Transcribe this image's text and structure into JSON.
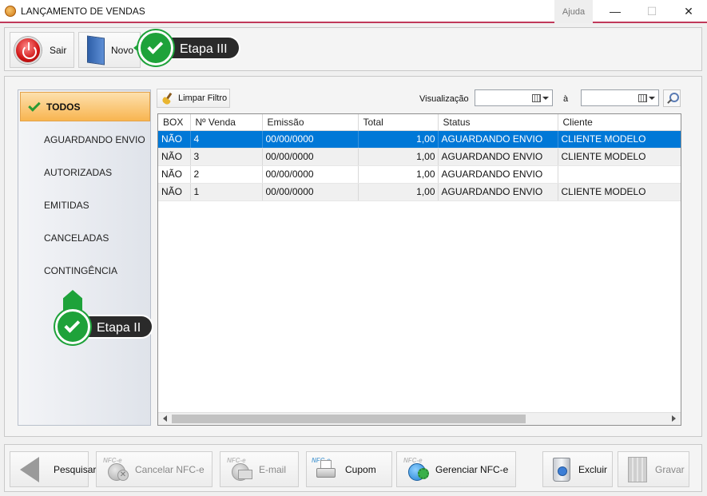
{
  "window": {
    "title": "LANÇAMENTO DE VENDAS",
    "help_label": "Ajuda",
    "minimize_glyph": "—",
    "maximize_glyph": "☐",
    "close_glyph": "✕"
  },
  "top_toolbar": {
    "exit_label": "Sair",
    "new_label": "Novo"
  },
  "callouts": {
    "step3": "Etapa III",
    "step2": "Etapa II",
    "color": "#1ea23a"
  },
  "sidebar": {
    "items": [
      {
        "label": "TODOS",
        "active": true
      },
      {
        "label": "AGUARDANDO ENVIO"
      },
      {
        "label": "AUTORIZADAS"
      },
      {
        "label": "EMITIDAS"
      },
      {
        "label": "CANCELADAS"
      },
      {
        "label": "CONTINGÊNCIA"
      }
    ]
  },
  "filter": {
    "clear_label": "Limpar Filtro",
    "view_label": "Visualização",
    "to_label": "à",
    "date_from": "",
    "date_to": ""
  },
  "grid": {
    "columns": [
      "BOX",
      "Nº Venda",
      "Emissão",
      "Total",
      "Status",
      "Cliente"
    ],
    "rows": [
      {
        "box": "NÃO",
        "venda": "4",
        "emissao": "00/00/0000",
        "total": "1,00",
        "status": "AGUARDANDO ENVIO",
        "cliente": "CLIENTE MODELO",
        "selected": true
      },
      {
        "box": "NÃO",
        "venda": "3",
        "emissao": "00/00/0000",
        "total": "1,00",
        "status": "AGUARDANDO ENVIO",
        "cliente": "CLIENTE MODELO"
      },
      {
        "box": "NÃO",
        "venda": "2",
        "emissao": "00/00/0000",
        "total": "1,00",
        "status": "AGUARDANDO ENVIO",
        "cliente": ""
      },
      {
        "box": "NÃO",
        "venda": "1",
        "emissao": "00/00/0000",
        "total": "1,00",
        "status": "AGUARDANDO ENVIO",
        "cliente": "CLIENTE MODELO"
      }
    ],
    "selected_color": "#0078d7"
  },
  "bottom_toolbar": {
    "search_label": "Pesquisar",
    "cancel_label": "Cancelar NFC-e",
    "email_label": "E-mail",
    "coupon_label": "Cupom",
    "manage_label": "Gerenciar NFC-e",
    "delete_label": "Excluir",
    "save_label": "Gravar",
    "nfe_badge": "NFC-e"
  }
}
